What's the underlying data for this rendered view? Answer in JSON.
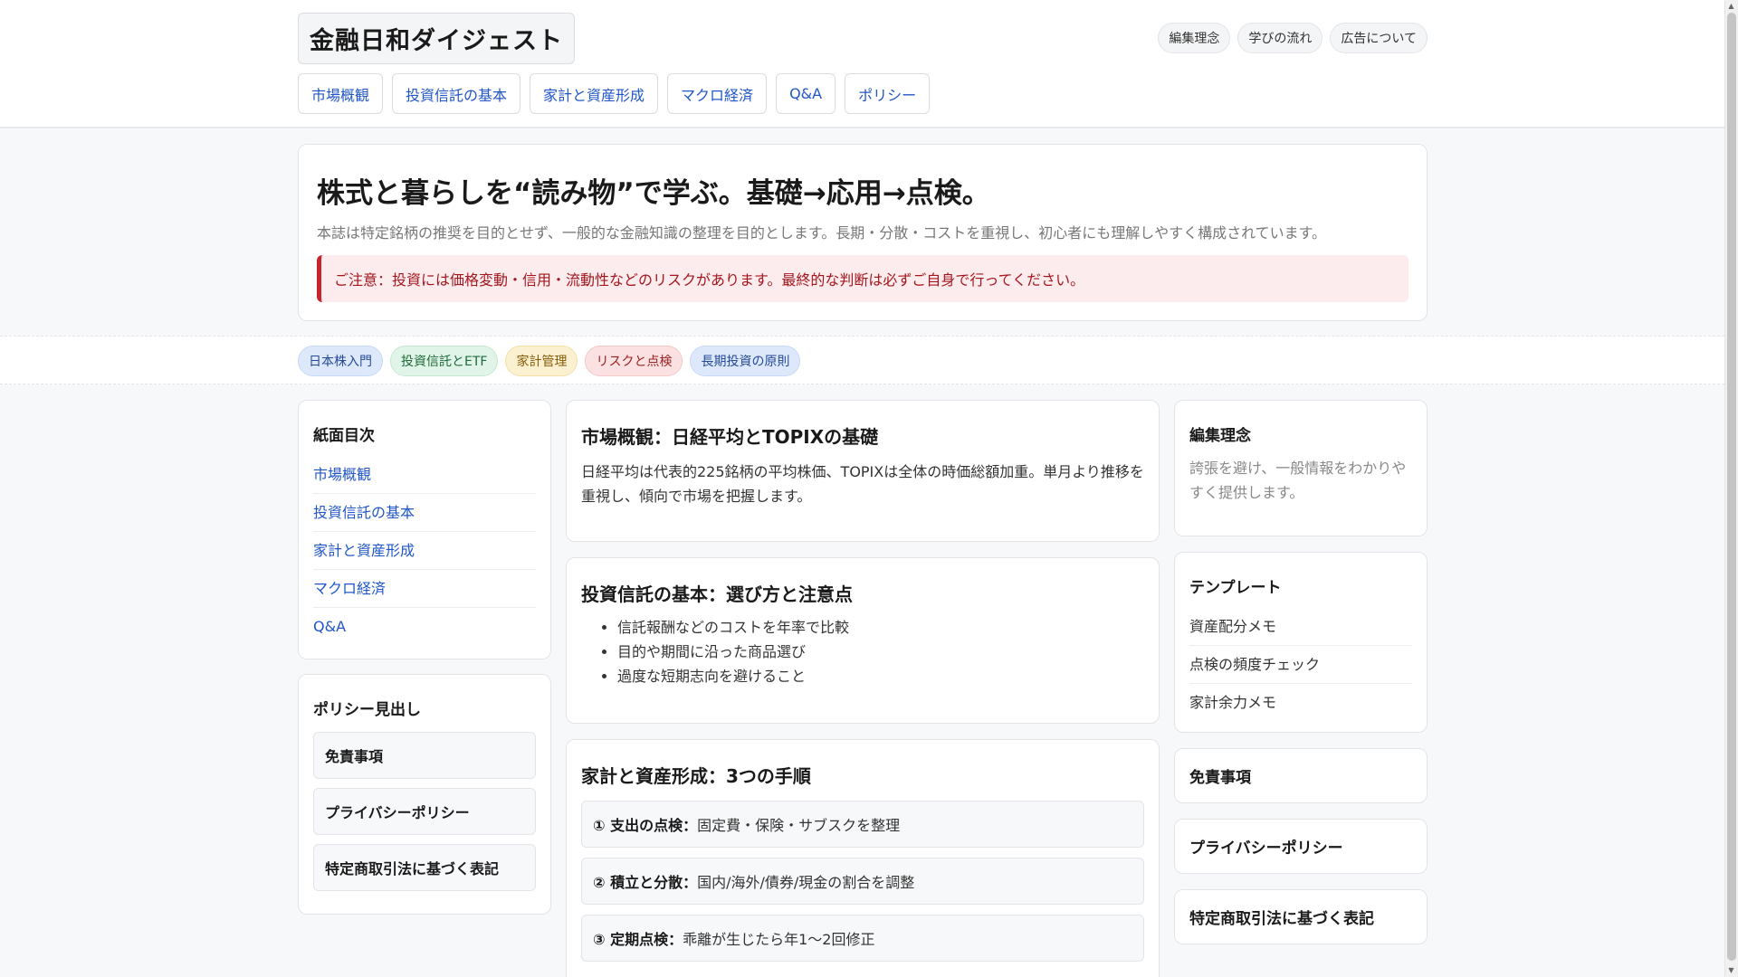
{
  "header": {
    "brand": "金融日和ダイジェスト",
    "links": [
      "編集理念",
      "学びの流れ",
      "広告について"
    ],
    "nav": [
      "市場概観",
      "投資信託の基本",
      "家計と資産形成",
      "マクロ経済",
      "Q&A",
      "ポリシー"
    ]
  },
  "hero": {
    "title": "株式と暮らしを“読み物”で学ぶ。基礎→応用→点検。",
    "lead": "本誌は特定銘柄の推奨を目的とせず、一般的な金融知識の整理を目的とします。長期・分散・コストを重視し、初心者にも理解しやすく構成されています。",
    "alert": "ご注意：投資には価格変動・信用・流動性などのリスクがあります。最終的な判断は必ずご自身で行ってください。"
  },
  "tags": [
    {
      "label": "日本株入門",
      "color": "blue"
    },
    {
      "label": "投資信託とETF",
      "color": "green"
    },
    {
      "label": "家計管理",
      "color": "yellow"
    },
    {
      "label": "リスクと点検",
      "color": "red"
    },
    {
      "label": "長期投資の原則",
      "color": "blue"
    }
  ],
  "toc": {
    "title": "紙面目次",
    "items": [
      "市場概観",
      "投資信託の基本",
      "家計と資産形成",
      "マクロ経済",
      "Q&A"
    ]
  },
  "policy_heads": {
    "title": "ポリシー見出し",
    "items": [
      "免責事項",
      "プライバシーポリシー",
      "特定商取引法に基づく表記"
    ]
  },
  "articles": {
    "market": {
      "title": "市場概観：日経平均とTOPIXの基礎",
      "body": "日経平均は代表的225銘柄の平均株価、TOPIXは全体の時価総額加重。単月より推移を重視し、傾向で市場を把握します。"
    },
    "funds": {
      "title": "投資信託の基本：選び方と注意点",
      "bullets": [
        "信託報酬などのコストを年率で比較",
        "目的や期間に沿った商品選び",
        "過度な短期志向を避けること"
      ]
    },
    "household": {
      "title": "家計と資産形成：3つの手順",
      "steps": [
        {
          "head": "① 支出の点検：",
          "text": "固定費・保険・サブスクを整理"
        },
        {
          "head": "② 積立と分散：",
          "text": "国内/海外/債券/現金の割合を調整"
        },
        {
          "head": "③ 定期点検：",
          "text": "乖離が生じたら年1〜2回修正"
        }
      ]
    }
  },
  "sidebar": {
    "philosophy": {
      "title": "編集理念",
      "text": "誇張を避け、一般情報をわかりやすく提供します。"
    },
    "templates": {
      "title": "テンプレート",
      "items": [
        "資産配分メモ",
        "点検の頻度チェック",
        "家計余力メモ"
      ]
    },
    "links": [
      "免責事項",
      "プライバシーポリシー",
      "特定商取引法に基づく表記"
    ]
  }
}
